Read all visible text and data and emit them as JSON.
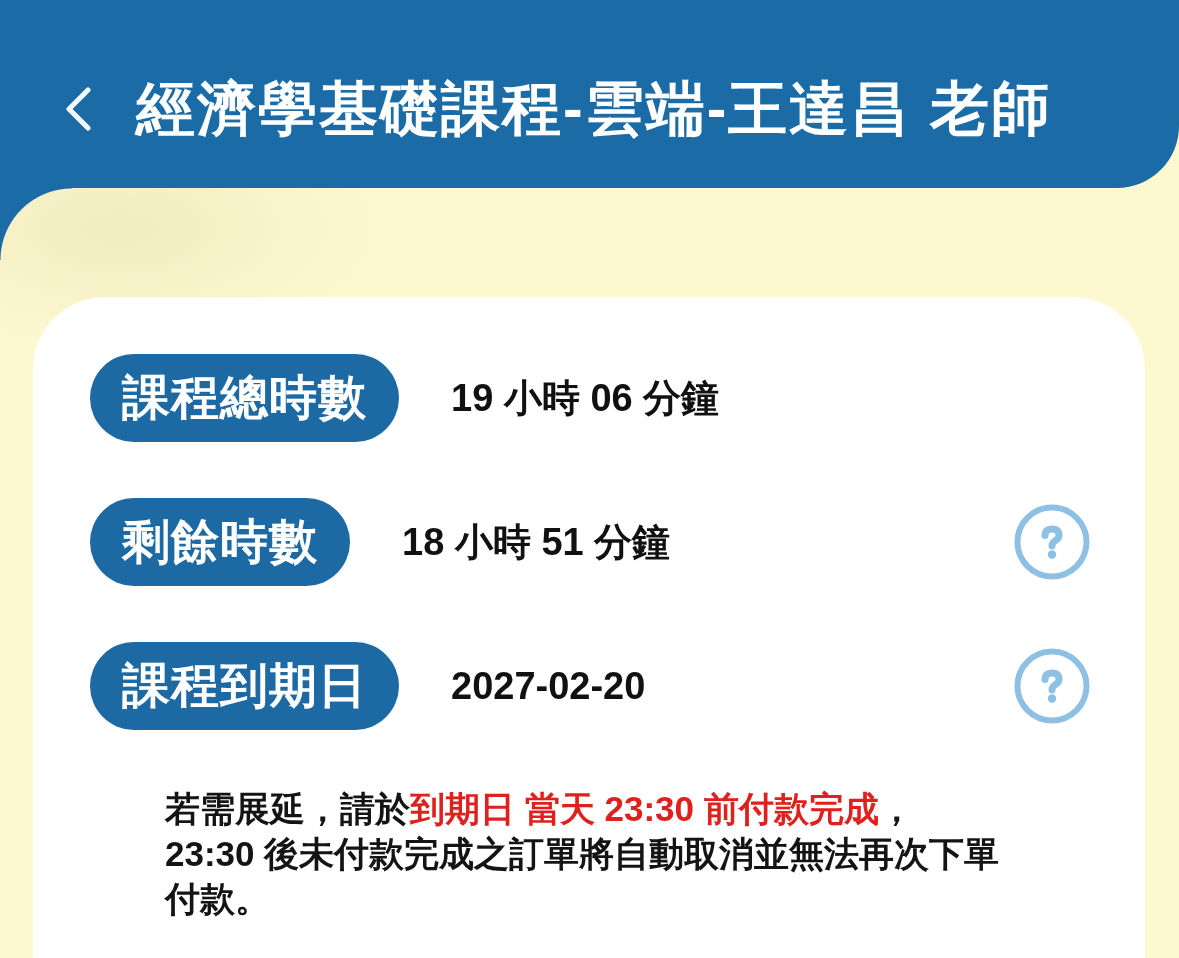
{
  "header": {
    "title": "經濟學基礎課程-雲端-王達昌 老師"
  },
  "rows": [
    {
      "label": "課程總時數",
      "value": "19 小時 06 分鐘",
      "help": false
    },
    {
      "label": "剩餘時數",
      "value": "18 小時 51 分鐘",
      "help": true
    },
    {
      "label": "課程到期日",
      "value": "2027-02-20",
      "help": true
    }
  ],
  "note": {
    "parts": [
      {
        "text": "若需展延，請於",
        "highlighted": false
      },
      {
        "text": "到期日 當天 23:30 前付款完成",
        "highlighted": true
      },
      {
        "text": "，\n23:30 後未付款完成之訂單將自動取消並無法再次下單付款。",
        "highlighted": false
      }
    ]
  }
}
